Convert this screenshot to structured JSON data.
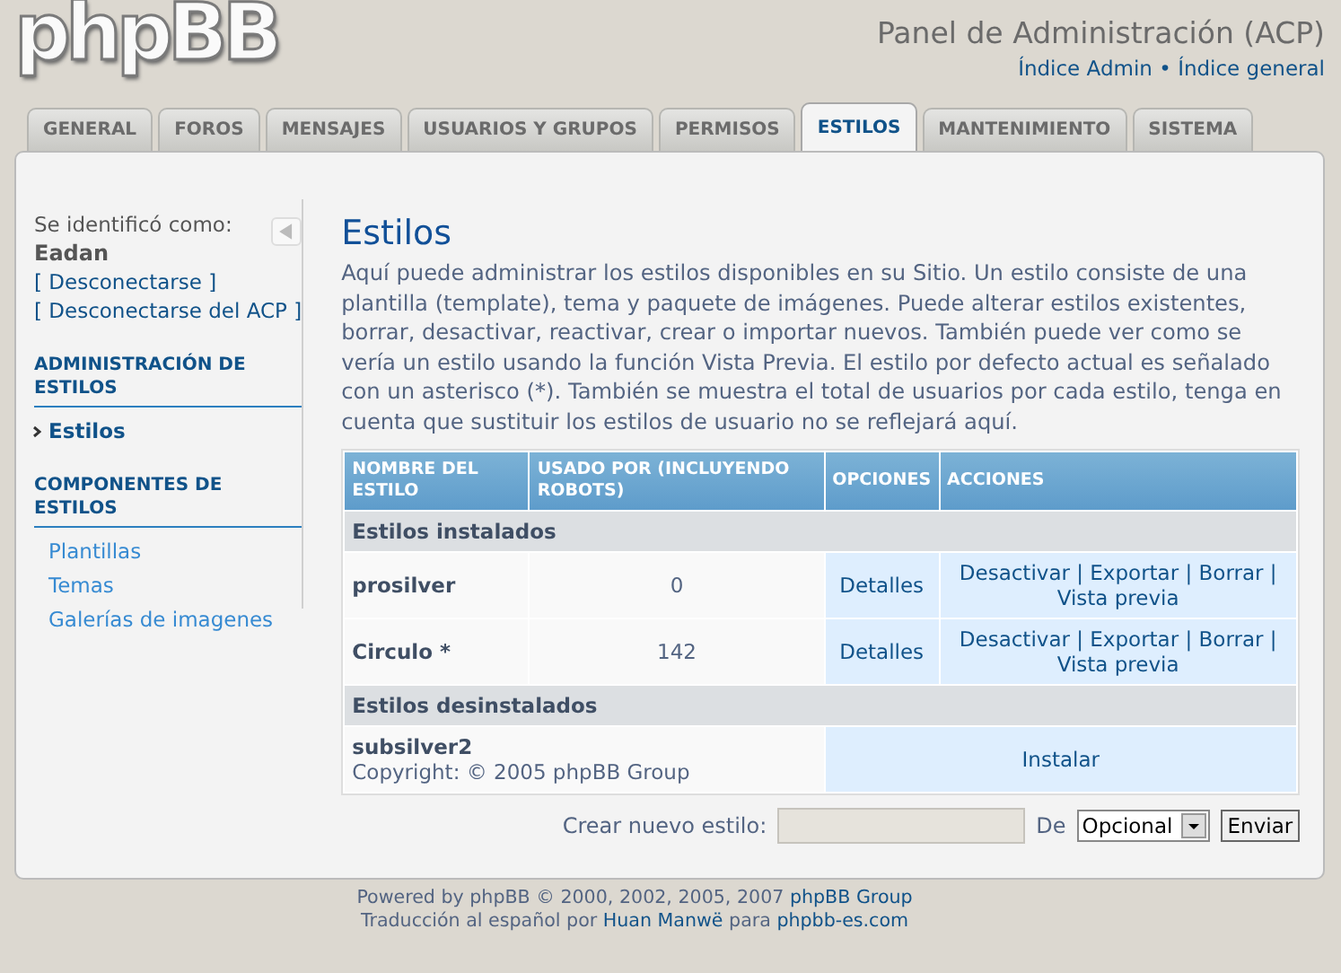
{
  "logo": "phpBB",
  "header": {
    "title": "Panel de Administración (ACP)",
    "links": [
      "Índice Admin",
      "Índice general"
    ],
    "separator": "•"
  },
  "tabs": [
    {
      "label": "GENERAL",
      "selected": false
    },
    {
      "label": "FOROS",
      "selected": false
    },
    {
      "label": "MENSAJES",
      "selected": false
    },
    {
      "label": "USUARIOS Y GRUPOS",
      "selected": false
    },
    {
      "label": "PERMISOS",
      "selected": false
    },
    {
      "label": "ESTILOS",
      "selected": true
    },
    {
      "label": "MANTENIMIENTO",
      "selected": false
    },
    {
      "label": "SISTEMA",
      "selected": false
    }
  ],
  "sidebar": {
    "user_label": "Se identificó como:",
    "username": "Eadan",
    "logout_links": [
      "[ Desconectarse ]",
      "[ Desconectarse del ACP ]"
    ],
    "sections": [
      {
        "title": "ADMINISTRACIÓN DE ESTILOS",
        "items": [
          {
            "label": "Estilos",
            "selected": true
          }
        ]
      },
      {
        "title": "COMPONENTES DE ESTILOS",
        "items": [
          {
            "label": "Plantillas",
            "selected": false
          },
          {
            "label": "Temas",
            "selected": false
          },
          {
            "label": "Galerías de imagenes",
            "selected": false
          }
        ]
      }
    ]
  },
  "main": {
    "title": "Estilos",
    "description": "Aquí puede administrar los estilos disponibles en su Sitio. Un estilo consiste de una plantilla (template), tema y paquete de imágenes. Puede alterar estilos existentes, borrar, desactivar, reactivar, crear o importar nuevos. También puede ver como se vería un estilo usando la función Vista Previa. El estilo por defecto actual es señalado con un asterisco (*). También se muestra el total de usuarios por cada estilo, tenga en cuenta que sustituir los estilos de usuario no se reflejará aquí.",
    "table": {
      "columns": [
        "NOMBRE DEL ESTILO",
        "USADO POR (INCLUYENDO ROBOTS)",
        "OPCIONES",
        "ACCIONES"
      ],
      "action_separator": "|",
      "groups": [
        {
          "title": "Estilos instalados",
          "rows": [
            {
              "kind": "installed",
              "name": "prosilver",
              "used_by": "0",
              "option": "Detalles",
              "actions": [
                "Desactivar",
                "Exportar",
                "Borrar",
                "Vista previa"
              ]
            },
            {
              "kind": "installed",
              "name": "Circulo *",
              "used_by": "142",
              "option": "Detalles",
              "actions": [
                "Desactivar",
                "Exportar",
                "Borrar",
                "Vista previa"
              ]
            }
          ]
        },
        {
          "title": "Estilos desinstalados",
          "rows": [
            {
              "kind": "uninstalled",
              "name": "subsilver2",
              "copyright": "Copyright: © 2005 phpBB Group",
              "actions": [
                "Instalar"
              ]
            }
          ]
        }
      ]
    },
    "create": {
      "label": "Crear nuevo estilo:",
      "from_label": "De",
      "select": "Opcional",
      "button": "Enviar"
    }
  },
  "footer": [
    [
      {
        "text": "Powered by phpBB © 2000, 2002, 2005, 2007 ",
        "link": false
      },
      {
        "text": "phpBB Group",
        "link": true
      }
    ],
    [
      {
        "text": "Traducción al español por ",
        "link": false
      },
      {
        "text": "Huan Manwë",
        "link": true
      },
      {
        "text": " para ",
        "link": false
      },
      {
        "text": "phpbb-es.com",
        "link": true
      }
    ]
  ]
}
